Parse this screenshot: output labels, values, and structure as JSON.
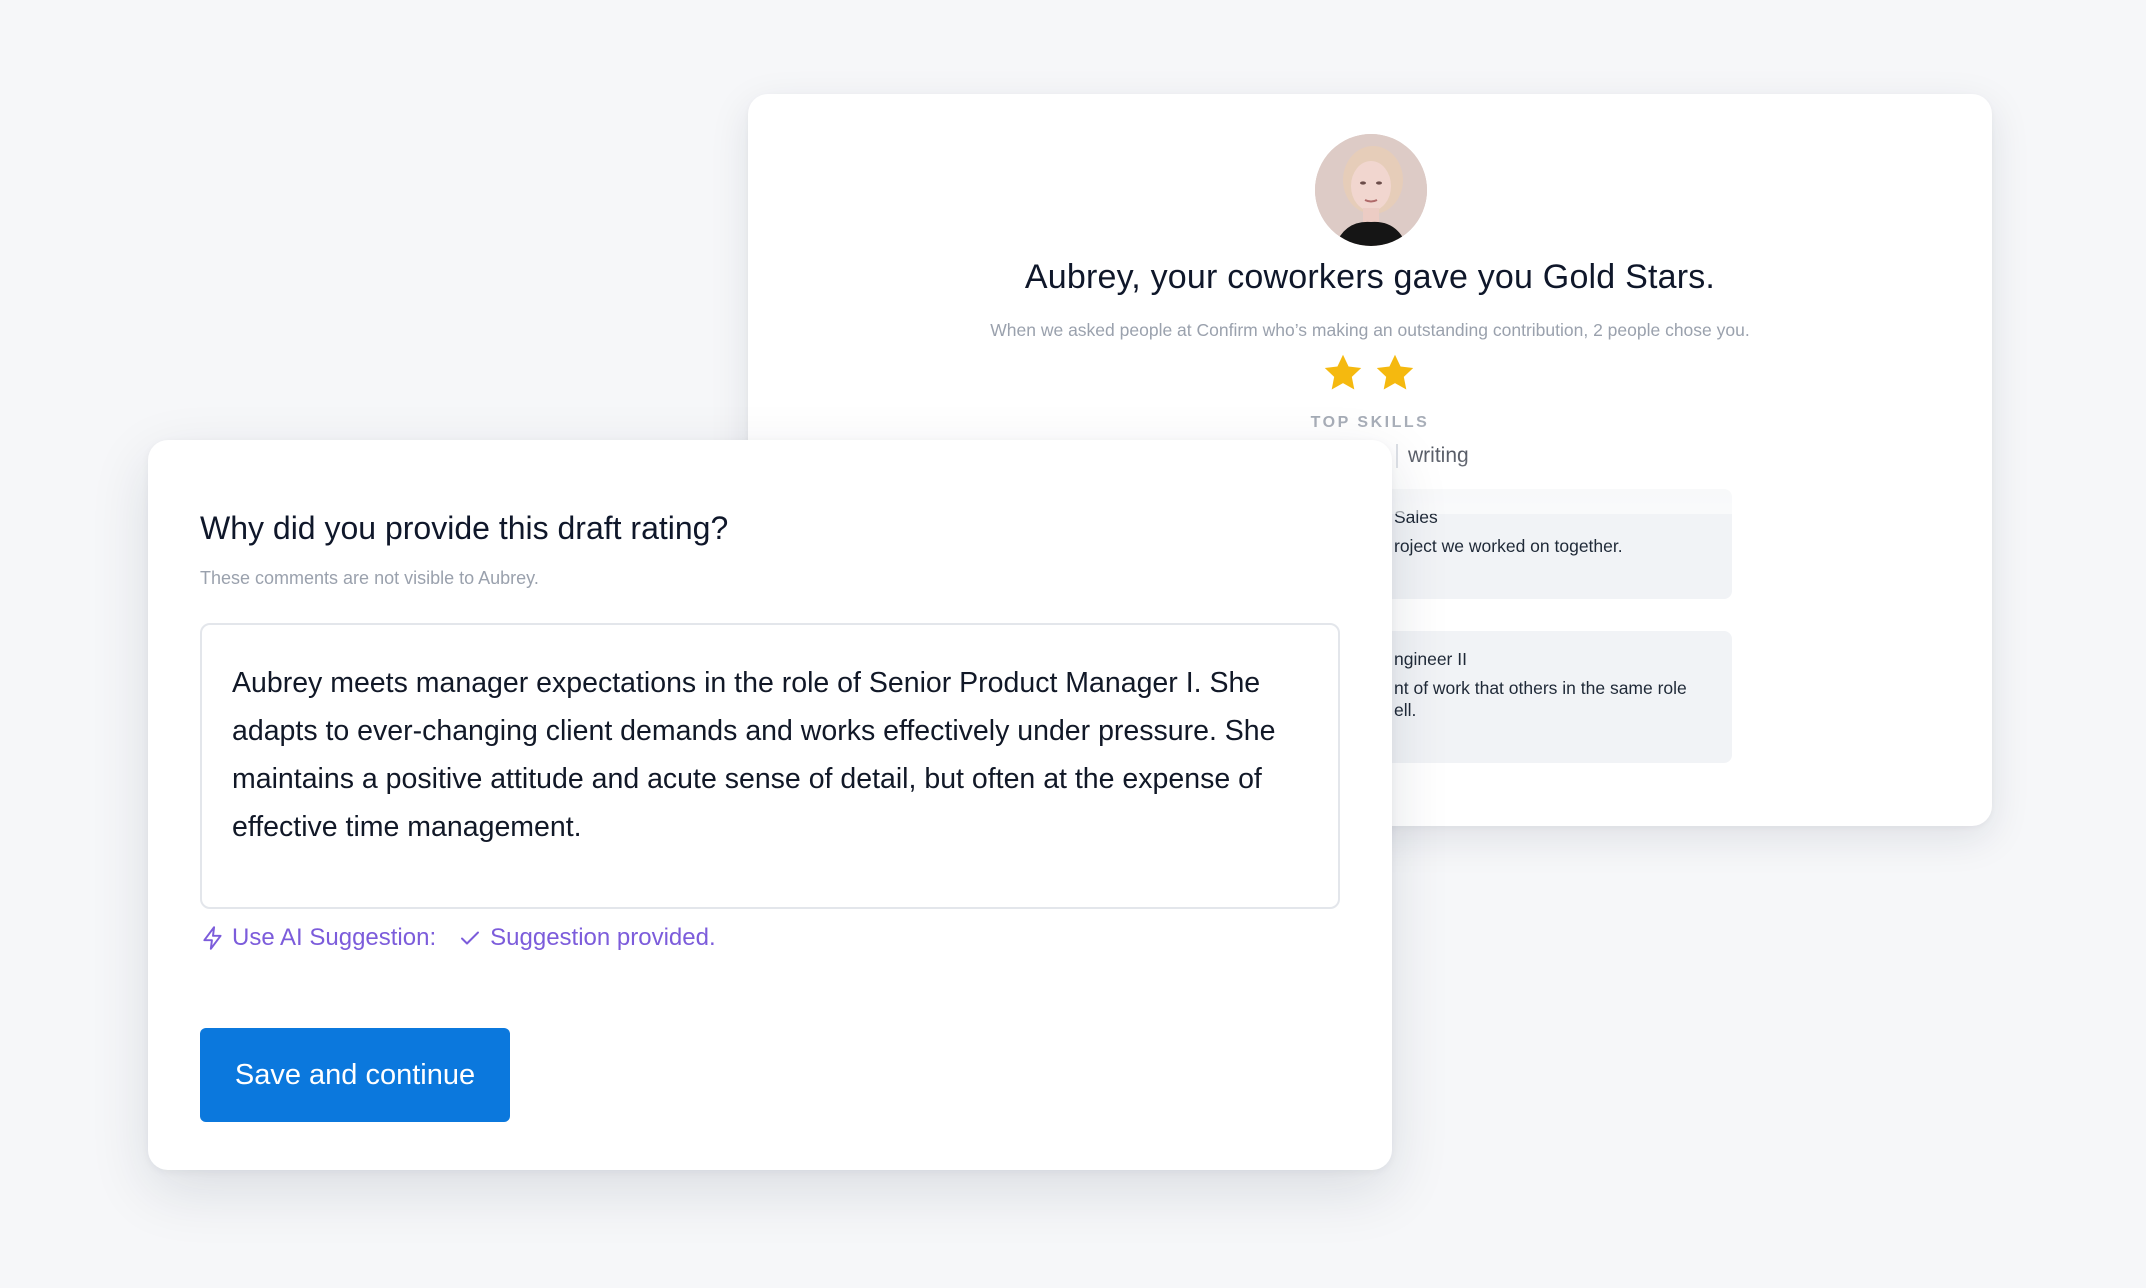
{
  "background_card": {
    "title": "Aubrey, your coworkers gave you Gold Stars.",
    "subtitle": "When we asked people at Confirm who’s making an outstanding contribution, 2 people chose you.",
    "star_count": 2,
    "star_color": "#f5b90f",
    "top_skills_label": "TOP SKILLS",
    "skill": "writing",
    "testimonials": [
      {
        "name": "Sales",
        "text": "roject we worked on together."
      },
      {
        "name": "ngineer II",
        "text": "nt of work that others in the same role\nell."
      }
    ]
  },
  "foreground_card": {
    "title": "Why did you provide this draft rating?",
    "subtitle": "These comments are not visible to Aubrey.",
    "comment_text": "Aubrey meets manager expectations in the role of Senior Product Manager I. She adapts to ever-changing client demands and works effectively under pressure. She maintains a positive attitude and acute sense of detail, but often at the expense of effective time management.",
    "ai_suggestion_label": "Use AI Suggestion:",
    "suggestion_status": "Suggestion provided.",
    "save_button_label": "Save and continue",
    "accent_color": "#7c5cdb",
    "button_color": "#0b78dd"
  }
}
